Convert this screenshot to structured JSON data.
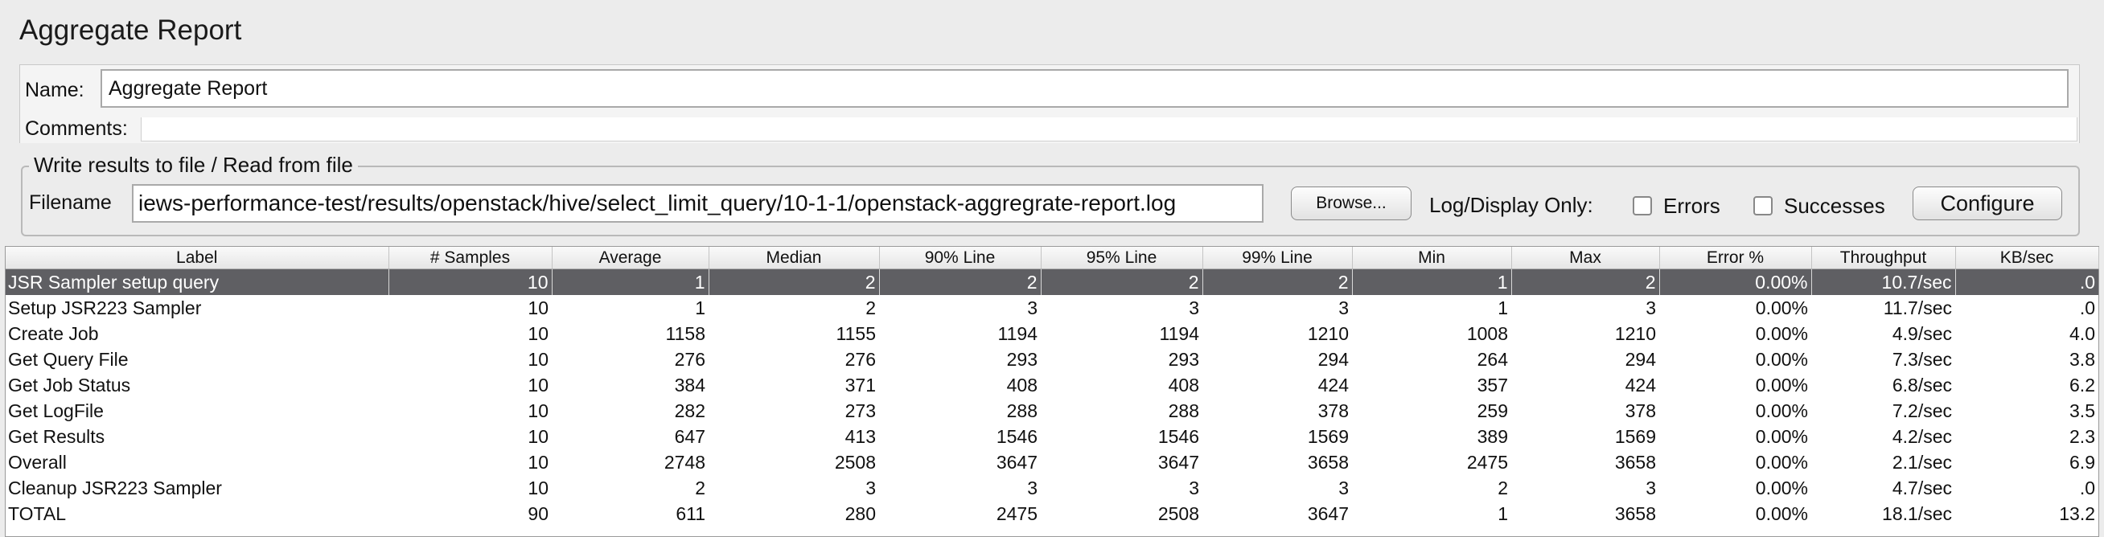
{
  "panel": {
    "title": "Aggregate Report"
  },
  "name_field": {
    "label": "Name:",
    "value": "Aggregate Report"
  },
  "comments_field": {
    "label": "Comments:"
  },
  "file_section": {
    "legend": "Write results to file / Read from file",
    "filename_label": "Filename",
    "filename_value": "iews-performance-test/results/openstack/hive/select_limit_query/10-1-1/openstack-aggregrate-report.log",
    "browse_label": "Browse...",
    "log_display_label": "Log/Display Only:",
    "errors_label": "Errors",
    "successes_label": "Successes",
    "configure_label": "Configure"
  },
  "table": {
    "columns": [
      "Label",
      "# Samples",
      "Average",
      "Median",
      "90% Line",
      "95% Line",
      "99% Line",
      "Min",
      "Max",
      "Error %",
      "Throughput",
      "KB/sec"
    ],
    "selected_row": 0,
    "rows": [
      [
        "JSR Sampler setup query",
        "10",
        "1",
        "2",
        "2",
        "2",
        "2",
        "1",
        "2",
        "0.00%",
        "10.7/sec",
        ".0"
      ],
      [
        "Setup JSR223 Sampler",
        "10",
        "1",
        "2",
        "3",
        "3",
        "3",
        "1",
        "3",
        "0.00%",
        "11.7/sec",
        ".0"
      ],
      [
        "Create Job",
        "10",
        "1158",
        "1155",
        "1194",
        "1194",
        "1210",
        "1008",
        "1210",
        "0.00%",
        "4.9/sec",
        "4.0"
      ],
      [
        "Get Query File",
        "10",
        "276",
        "276",
        "293",
        "293",
        "294",
        "264",
        "294",
        "0.00%",
        "7.3/sec",
        "3.8"
      ],
      [
        "Get Job Status",
        "10",
        "384",
        "371",
        "408",
        "408",
        "424",
        "357",
        "424",
        "0.00%",
        "6.8/sec",
        "6.2"
      ],
      [
        "Get LogFile",
        "10",
        "282",
        "273",
        "288",
        "288",
        "378",
        "259",
        "378",
        "0.00%",
        "7.2/sec",
        "3.5"
      ],
      [
        "Get Results",
        "10",
        "647",
        "413",
        "1546",
        "1546",
        "1569",
        "389",
        "1569",
        "0.00%",
        "4.2/sec",
        "2.3"
      ],
      [
        "Overall",
        "10",
        "2748",
        "2508",
        "3647",
        "3647",
        "3658",
        "2475",
        "3658",
        "0.00%",
        "2.1/sec",
        "6.9"
      ],
      [
        "Cleanup JSR223 Sampler",
        "10",
        "2",
        "3",
        "3",
        "3",
        "3",
        "2",
        "3",
        "0.00%",
        "4.7/sec",
        ".0"
      ],
      [
        "TOTAL",
        "90",
        "611",
        "280",
        "2475",
        "2508",
        "3647",
        "1",
        "3658",
        "0.00%",
        "18.1/sec",
        "13.2"
      ]
    ]
  }
}
